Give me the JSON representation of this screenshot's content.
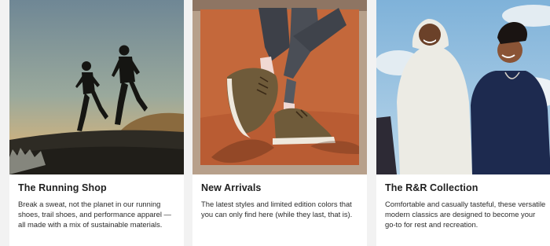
{
  "cards": [
    {
      "title": "The Running Shop",
      "description": "Break a sweat, not the planet in our running shoes, trail shoes, and performance apparel — all made with a mix of sustainable materials."
    },
    {
      "title": "New Arrivals",
      "description": "The latest styles and limited edition colors that you can only find here (while they last, that is)."
    },
    {
      "title": "The R&R Collection",
      "description": "Comfortable and casually tasteful, these versatile modern classics are designed to become your go-to for rest and recreation."
    }
  ],
  "colors": {
    "page_background": "#f2f2f2",
    "card_background": "#ffffff",
    "heading_text": "#212121",
    "new_arrivals_backdrop": "#c4683b"
  }
}
